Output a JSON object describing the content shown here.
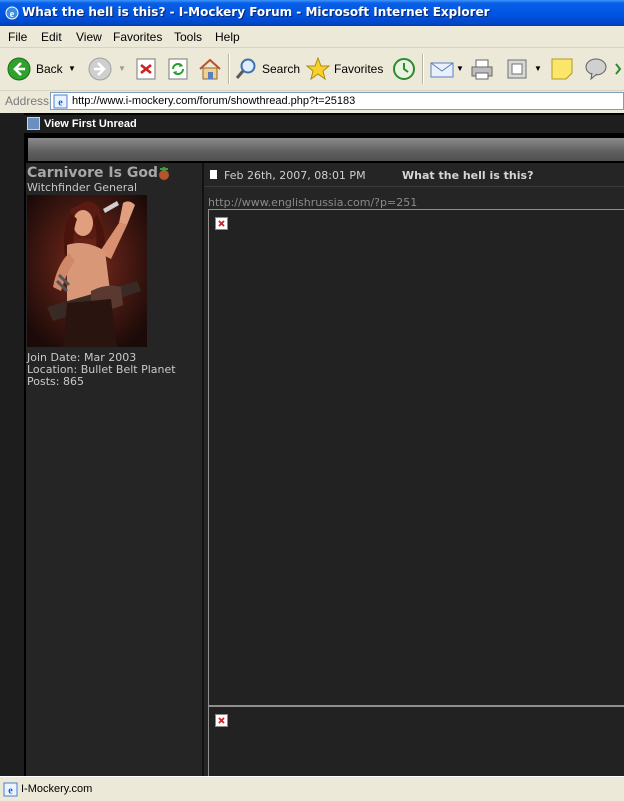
{
  "window": {
    "title": "What the hell is this? - I-Mockery Forum - Microsoft Internet Explorer"
  },
  "menu": {
    "items": [
      "File",
      "Edit",
      "View",
      "Favorites",
      "Tools",
      "Help"
    ]
  },
  "toolbar": {
    "back_label": "Back",
    "search_label": "Search",
    "favorites_label": "Favorites"
  },
  "address": {
    "label": "Address",
    "url": "http://www.i-mockery.com/forum/showthread.php?t=25183"
  },
  "forum": {
    "view_first_unread": "View First Unread",
    "post": {
      "username": "Carnivore Is God",
      "user_title": "Witchfinder General",
      "join_date": "Join Date: Mar 2003",
      "location": "Location: Bullet Belt Planet",
      "posts": "Posts: 865",
      "date": "Feb 26th, 2007, 08:01 PM",
      "title": "What the hell is this?",
      "link": "http://www.englishrussia.com/?p=251"
    }
  },
  "status": {
    "text": "I-Mockery.com"
  },
  "icons": {
    "app": "ie-icon",
    "back": "back-arrow-icon",
    "forward": "forward-arrow-icon",
    "stop": "stop-icon",
    "refresh": "refresh-icon",
    "home": "home-icon",
    "search": "search-icon",
    "favorites": "star-icon",
    "history": "history-icon",
    "mail": "mail-icon",
    "print": "print-icon",
    "edit": "edit-icon",
    "note": "note-icon",
    "messenger": "messenger-icon"
  },
  "colors": {
    "titlebar": "#0055e5",
    "page_bg": "#252525",
    "link": "#8a8a8a"
  }
}
